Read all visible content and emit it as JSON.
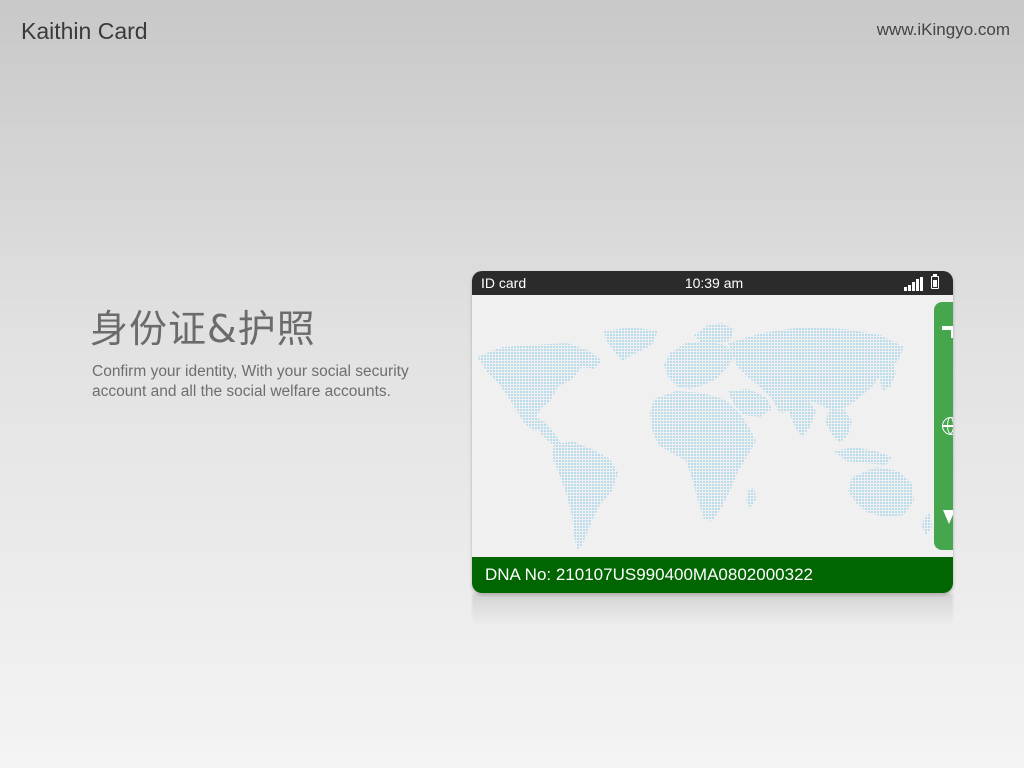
{
  "app": {
    "brand": "Kaithin Card",
    "site_url": "www.iKingyo.com"
  },
  "feature": {
    "title": "身份证&护照",
    "description": "Confirm your identity, With your social security account and all the social welfare accounts."
  },
  "device": {
    "status_bar": {
      "label": "ID card",
      "time": "10:39 am"
    },
    "dna_label": "DNA No: 210107US990400MA0802000322",
    "icons": [
      "signal-icon",
      "battery-icon",
      "globe-icon"
    ],
    "colors": {
      "status_bar": "#2b2b2b",
      "panel_green": "#45a64d",
      "dna_bar": "#016501",
      "map_dots": "#b9dced"
    }
  }
}
